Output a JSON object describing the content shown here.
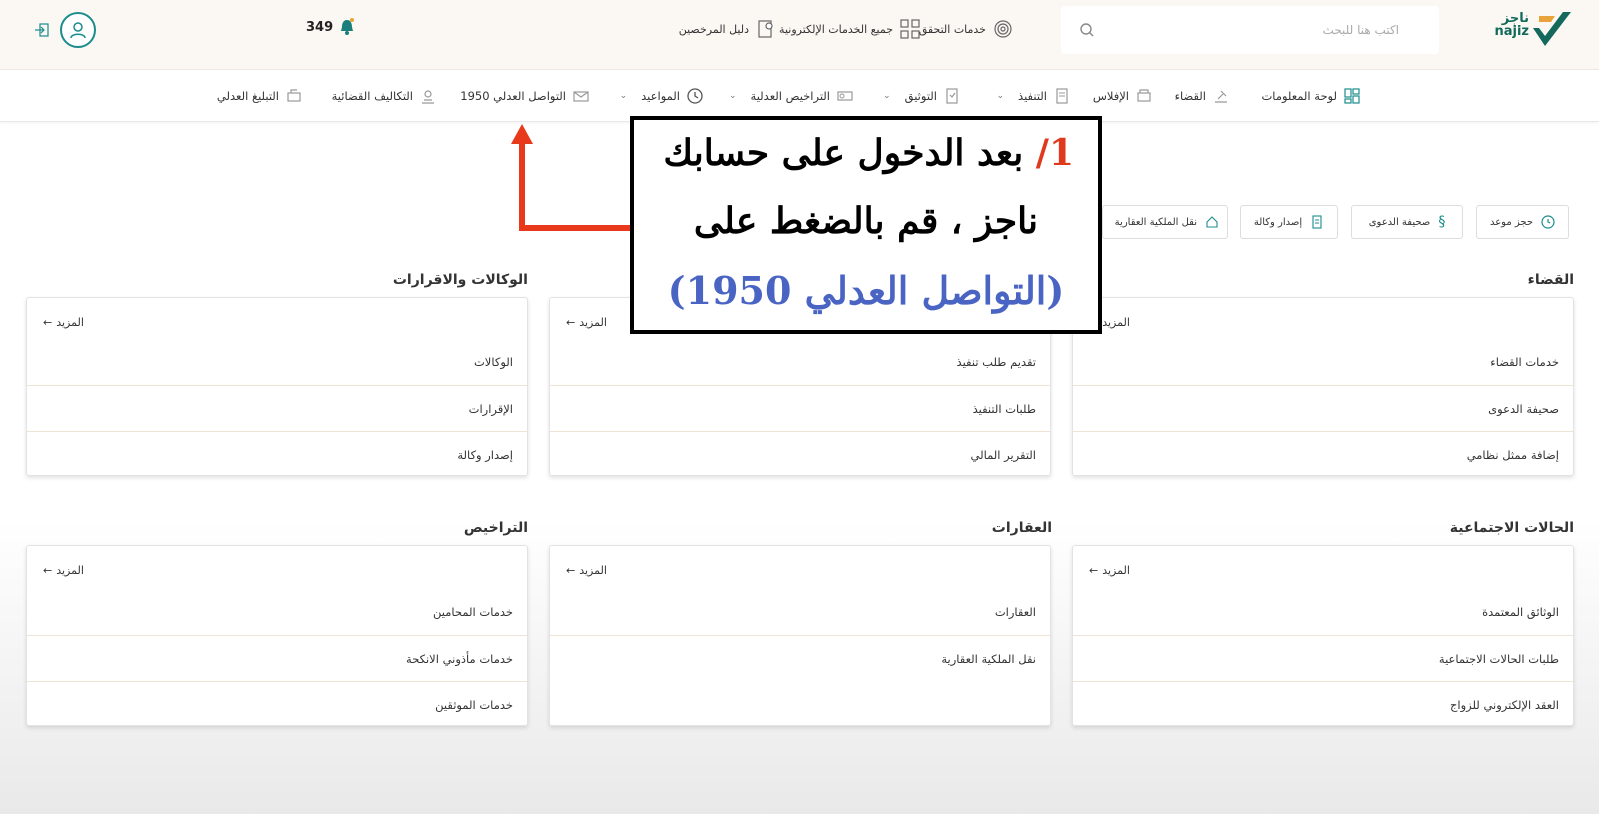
{
  "header": {
    "search_placeholder": "اكتب هنا للبحث",
    "links": {
      "verify": "خدمات التحقق",
      "all_services": "جميع الخدمات الإلكترونية",
      "licensees_guide": "دليل المرخصين"
    },
    "notifications_count": "349"
  },
  "nav": {
    "items": [
      {
        "label": "لوحة المعلومات",
        "icon": "dashboard-icon"
      },
      {
        "label": "القضاء",
        "icon": "gavel-icon"
      },
      {
        "label": "الإفلاس",
        "icon": "bankruptcy-icon"
      },
      {
        "label": "التنفيذ",
        "icon": "execution-icon",
        "dropdown": true
      },
      {
        "label": "التوثيق",
        "icon": "document-icon",
        "dropdown": true
      },
      {
        "label": "التراخيص العدلية",
        "icon": "license-icon",
        "dropdown": true
      },
      {
        "label": "المواعيد",
        "icon": "clock-icon",
        "dropdown": true
      },
      {
        "label": "التواصل العدلي 1950",
        "icon": "mail-icon"
      },
      {
        "label": "التكاليف القضائية",
        "icon": "costs-icon"
      },
      {
        "label": "التبليغ العدلي",
        "icon": "notify-icon"
      }
    ]
  },
  "quick_buttons": {
    "book_appointment": "حجز موعد",
    "lawsuit_sheet": "صحيفة الدعوى",
    "issue_power": "إصدار وكالة",
    "transfer_property": "نقل الملكية العقارية"
  },
  "sections": {
    "judiciary": {
      "title": "القضاء",
      "more": "المزيد",
      "items": [
        "خدمات القضاء",
        "صحيفة الدعوى",
        "إضافة ممثل نظامي"
      ]
    },
    "execution": {
      "more": "المزيد",
      "items": [
        "تقديم طلب تنفيذ",
        "طلبات التنفيذ",
        "التقرير المالي"
      ]
    },
    "powers": {
      "title": "الوكالات والاقرارات",
      "more": "المزيد",
      "items": [
        "الوكالات",
        "الإقرارات",
        "إصدار وكالة"
      ]
    },
    "social": {
      "title": "الحالات الاجتماعية",
      "more": "المزيد",
      "items": [
        "الوثائق المعتمدة",
        "طلبات الحالات الاجتماعية",
        "العقد الإلكتروني للزواج"
      ]
    },
    "realestate": {
      "title": "العقارات",
      "more": "المزيد",
      "items": [
        "العقارات",
        "نقل الملكية العقارية"
      ]
    },
    "licenses": {
      "title": "التراخيص",
      "more": "المزيد",
      "items": [
        "خدمات المحامين",
        "خدمات مأذوني الانكحة",
        "خدمات الموثقين"
      ]
    }
  },
  "annotation": {
    "step": "1/",
    "line1": "بعد الدخول على حسابك",
    "line2": "ناجز ، قم بالضغط على",
    "line3": "(التواصل العدلي 1950)"
  },
  "colors": {
    "brand_green": "#136a5c",
    "accent_teal": "#1a8c8c",
    "arrow_red": "#e8391c",
    "annotation_blue": "#4a64c4"
  }
}
